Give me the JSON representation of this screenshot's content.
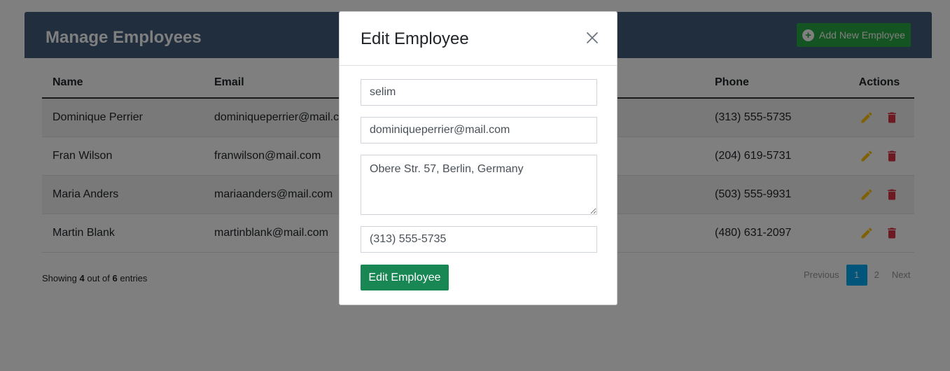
{
  "panel": {
    "title": "Manage Employees",
    "add_button_label": "Add New Employee"
  },
  "table": {
    "headers": {
      "name": "Name",
      "email": "Email",
      "phone": "Phone",
      "actions": "Actions"
    },
    "rows": [
      {
        "name": "Dominique Perrier",
        "email": "dominiqueperrier@mail.com",
        "phone": "(313) 555-5735"
      },
      {
        "name": "Fran Wilson",
        "email": "franwilson@mail.com",
        "phone": "(204) 619-5731"
      },
      {
        "name": "Maria Anders",
        "email": "mariaanders@mail.com",
        "phone": "(503) 555-9931"
      },
      {
        "name": "Martin Blank",
        "email": "martinblank@mail.com",
        "phone": "(480) 631-2097"
      }
    ]
  },
  "footer": {
    "showing_prefix": "Showing",
    "shown_count": "4",
    "out_of": "out of",
    "total_count": "6",
    "entries": "entries"
  },
  "pagination": {
    "previous": "Previous",
    "pages": [
      "1",
      "2"
    ],
    "active_page": "1",
    "next": "Next"
  },
  "modal": {
    "title": "Edit Employee",
    "fields": {
      "name": "selim",
      "email": "dominiqueperrier@mail.com",
      "address": "Obere Str. 57, Berlin, Germany",
      "phone": "(313) 555-5735"
    },
    "submit_label": "Edit Employee"
  },
  "colors": {
    "header_bg": "#435d7d",
    "add_button": "#28a745",
    "edit_icon": "#ffc107",
    "delete_icon": "#dc3545",
    "active_page": "#03a9f4",
    "submit_button": "#198754"
  },
  "icons": {
    "add": "plus-circle-icon",
    "edit": "pencil-icon",
    "delete": "trash-icon",
    "close": "close-icon"
  }
}
